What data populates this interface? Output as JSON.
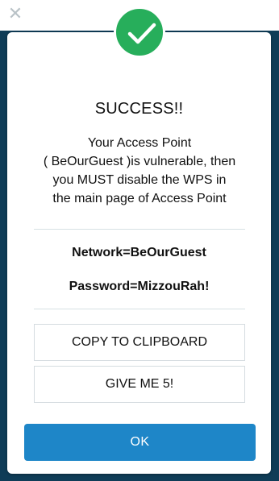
{
  "header": {
    "close_icon": "close-icon"
  },
  "dialog": {
    "status_icon": "checkmark-icon",
    "status_color": "#27ae5b",
    "title": "SUCCESS!!",
    "message_lines": [
      "Your Access Point",
      "( BeOurGuest )is vulnerable, then",
      "you MUST disable the WPS in",
      "the main page of Access Point"
    ],
    "network": "Network=BeOurGuest",
    "password": "Password=MizzouRah!",
    "copy_button": "COPY TO CLIPBOARD",
    "give_button": "GIVE ME 5!",
    "ok_button": "OK",
    "ok_color": "#1e86c8"
  }
}
